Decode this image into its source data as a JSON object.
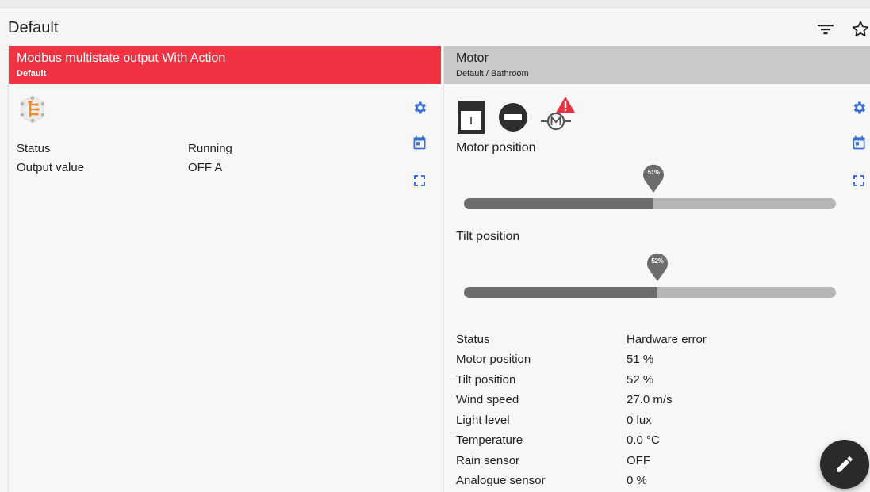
{
  "page": {
    "title": "Default",
    "toolbar": {
      "filter_icon": "filter-icon",
      "favorite_icon": "star-outline-icon"
    }
  },
  "left_card": {
    "title": "Modbus multistate output With Action",
    "subtitle": "Default",
    "header_color": "#ef3342",
    "device_icon": "modbus-network-icon",
    "actions": [
      "settings-gear-icon",
      "calendar-icon",
      "fullscreen-icon"
    ],
    "properties": [
      {
        "label": "Status",
        "value": "Running"
      },
      {
        "label": "Output value",
        "value": "OFF A"
      }
    ]
  },
  "right_card": {
    "title": "Motor",
    "subtitle": "Default / Bathroom",
    "header_color": "#c9c9cb",
    "status_icons": [
      "blind-down-icon",
      "stop-icon",
      "motor-error-icon"
    ],
    "actions": [
      "settings-gear-icon",
      "calendar-icon",
      "fullscreen-icon"
    ],
    "motor_position": {
      "label": "Motor position",
      "value": 51,
      "display": "51%"
    },
    "tilt_position": {
      "label": "Tilt position",
      "value": 52,
      "display": "52%"
    },
    "properties": [
      {
        "label": "Status",
        "value": "Hardware error"
      },
      {
        "label": "Motor position",
        "value": "51 %"
      },
      {
        "label": "Tilt position",
        "value": "52 %"
      },
      {
        "label": "Wind speed",
        "value": "27.0 m/s"
      },
      {
        "label": "Light level",
        "value": "0 lux"
      },
      {
        "label": "Temperature",
        "value": "0.0 °C"
      },
      {
        "label": "Rain sensor",
        "value": "OFF"
      },
      {
        "label": "Analogue sensor",
        "value": "0 %"
      }
    ]
  },
  "fab": {
    "icon": "edit-pencil-icon"
  },
  "colors": {
    "accent_blue": "#3b6fd4",
    "alert_red": "#ef3342",
    "fill_dark": "#6d6d6f",
    "track_light": "#b6b6b6"
  }
}
